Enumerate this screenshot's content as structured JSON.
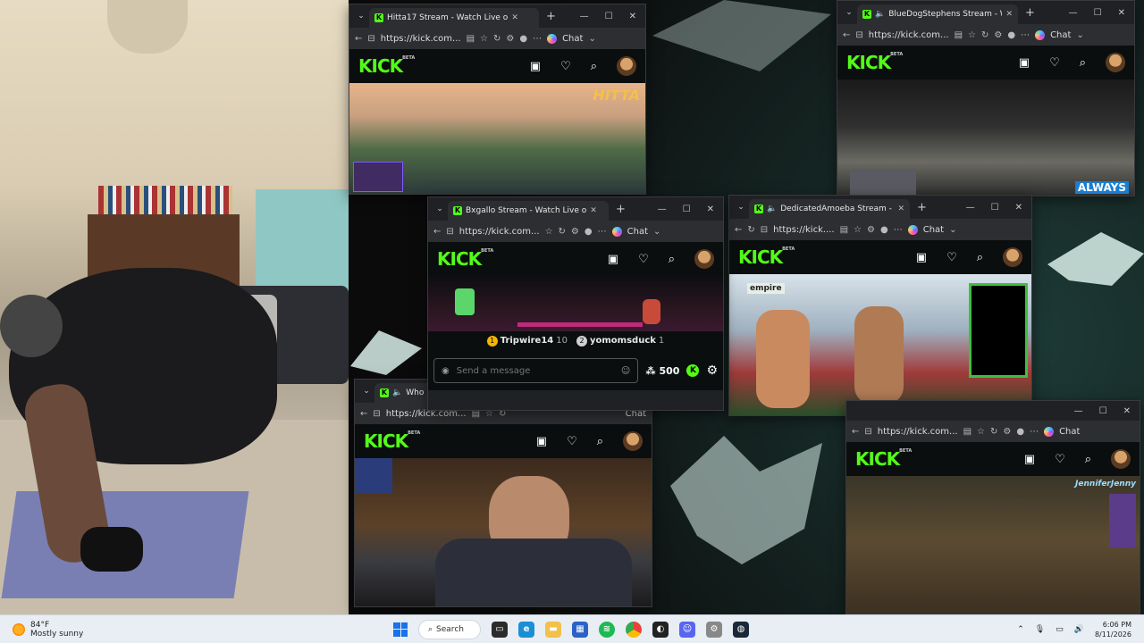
{
  "desktop": {
    "taskbar": {
      "weather": {
        "temp": "84°F",
        "condition": "Mostly sunny"
      },
      "search_label": "Search",
      "apps": [
        "file-explorer",
        "edge",
        "folder",
        "store",
        "spotify",
        "chrome",
        "notification-app",
        "discord",
        "settings",
        "steam"
      ],
      "clock": {
        "time": "6:06 PM",
        "date": "8/11/2026"
      }
    }
  },
  "windows": {
    "hitta": {
      "tab_title": "Hitta17 Stream - Watch Live o",
      "url": "https://kick.com...",
      "chat_label": "Chat",
      "overlay_brand": "HITTA"
    },
    "bluedog": {
      "tab_title": "BlueDogStephens Stream - W",
      "url": "https://kick.com...",
      "chat_label": "Chat",
      "overlay_brand": "ALWAYS"
    },
    "bxgallo": {
      "tab_title": "Bxgallo Stream - Watch Live o",
      "url": "https://kick.com...",
      "chat_label": "Chat",
      "top_chatters": [
        {
          "rank": "1",
          "name": "Tripwire14",
          "count": "10"
        },
        {
          "rank": "2",
          "name": "yomomsduck",
          "count": "1"
        }
      ],
      "message_placeholder": "Send a message",
      "points": "500"
    },
    "amoeba": {
      "tab_title": "DedicatedAmoeba Stream - W",
      "url": "https://kick....",
      "chat_label": "Chat",
      "overlay_brand": "empire"
    },
    "who": {
      "tab_title": "Who",
      "url": "https://kick.com...",
      "chat_label": "Chat"
    },
    "jennifer": {
      "url": "https://kick.com...",
      "chat_label": "Chat",
      "overlay_brand": "JenniferJenny"
    }
  },
  "kick": {
    "logo": "KICK",
    "beta": "BETA"
  }
}
